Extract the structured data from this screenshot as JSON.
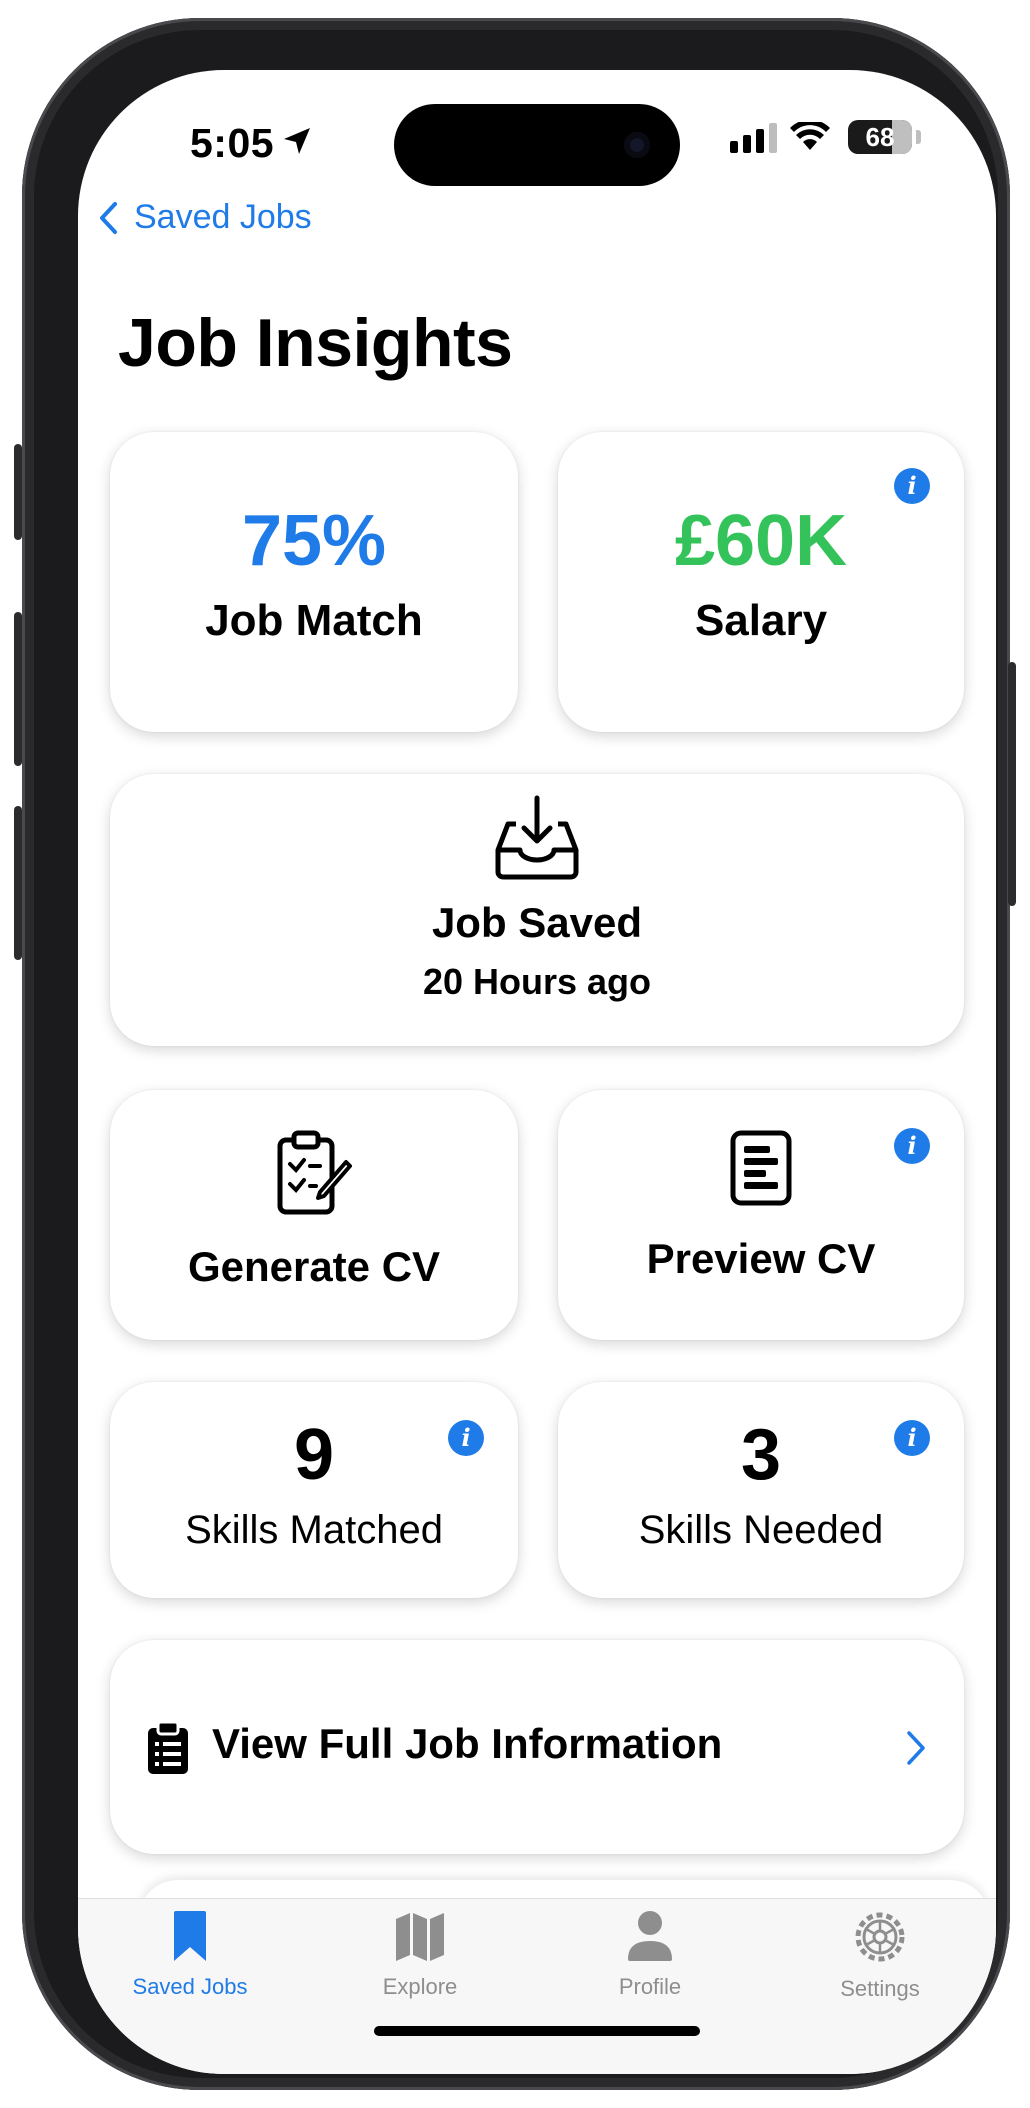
{
  "status_bar": {
    "time": "5:05",
    "battery": "68"
  },
  "nav": {
    "back_label": "Saved Jobs",
    "title": "Job Insights"
  },
  "cards": {
    "job_match": {
      "value": "75%",
      "label": "Job Match"
    },
    "salary": {
      "value": "£60K",
      "label": "Salary"
    },
    "job_saved": {
      "label": "Job Saved",
      "sub": "20 Hours ago"
    },
    "generate_cv": {
      "label": "Generate CV"
    },
    "preview_cv": {
      "label": "Preview CV"
    },
    "skills_matched": {
      "value": "9",
      "label": "Skills Matched"
    },
    "skills_needed": {
      "value": "3",
      "label": "Skills Needed"
    },
    "view_full": {
      "label": "View Full Job Information"
    }
  },
  "info_icon_glyph": "i",
  "tabbar": {
    "items": [
      {
        "label": "Saved Jobs",
        "icon": "bookmark-icon",
        "active": true
      },
      {
        "label": "Explore",
        "icon": "map-icon",
        "active": false
      },
      {
        "label": "Profile",
        "icon": "person-icon",
        "active": false
      },
      {
        "label": "Settings",
        "icon": "gear-icon",
        "active": false
      }
    ]
  },
  "colors": {
    "accent": "#1f7be8",
    "salary_green": "#34c35a",
    "inactive_tab": "#8e8e8e"
  }
}
